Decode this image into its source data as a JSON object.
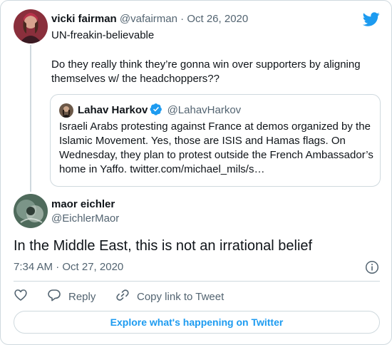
{
  "parent_tweet": {
    "author_name": "vicki fairman",
    "author_handle": "@vafairman",
    "separator": "·",
    "date": "Oct 26, 2020",
    "text_line1": "UN-freakin-believable",
    "text_line2": "Do they really think they’re gonna win over supporters by aligning themselves w/ the headchoppers??"
  },
  "quoted_tweet": {
    "author_name": "Lahav Harkov",
    "author_handle": "@LahavHarkov",
    "text": "Israeli Arabs protesting against France at demos organized by the Islamic Movement. Yes, those are ISIS and Hamas flags. On Wednesday, they plan to protest outside the French Ambassador’s home in Yaffo. twitter.com/michael_mils/s…"
  },
  "tweet": {
    "author_name": "maor eichler",
    "author_handle": "@EichlerMaor",
    "text": "In the Middle East, this is not an irrational belief",
    "timestamp": "7:34 AM · Oct 27, 2020"
  },
  "actions": {
    "reply_label": "Reply",
    "copy_link_label": "Copy link to Tweet"
  },
  "explore_label": "Explore what's happening on Twitter",
  "colors": {
    "accent": "#1d9bf0",
    "text": "#0f1419",
    "secondary": "#536471",
    "border": "#cfd9de"
  },
  "icons": {
    "brand": "twitter-bird-icon",
    "verified": "verified-badge-icon",
    "info": "info-icon",
    "like": "heart-icon",
    "reply": "reply-bubble-icon",
    "copy": "link-icon"
  }
}
